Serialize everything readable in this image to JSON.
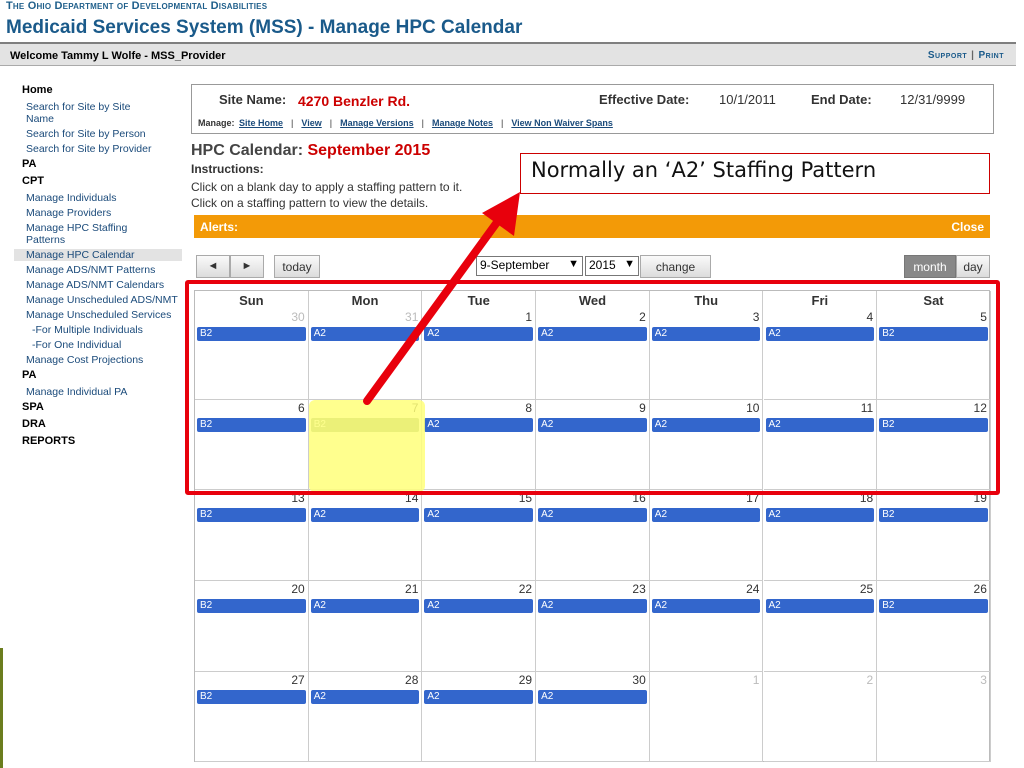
{
  "header": {
    "department": "The Ohio Department of Developmental Disabilities",
    "app_title": "Medicaid Services System (MSS) - Manage HPC Calendar"
  },
  "welcome": {
    "text": "Welcome Tammy L Wolfe - MSS_Provider",
    "support": "Support",
    "separator": "|",
    "print": "Print"
  },
  "sidebar": {
    "items": [
      {
        "label": "Home",
        "type": "header"
      },
      {
        "label": "Search for Site by Site Name",
        "type": "link"
      },
      {
        "label": "Search for Site by Person",
        "type": "link"
      },
      {
        "label": "Search for Site by Provider",
        "type": "link"
      },
      {
        "label": "PA",
        "type": "header"
      },
      {
        "label": "CPT",
        "type": "header"
      },
      {
        "label": "Manage Individuals",
        "type": "link"
      },
      {
        "label": "Manage Providers",
        "type": "link"
      },
      {
        "label": "Manage HPC Staffing Patterns",
        "type": "link"
      },
      {
        "label": "Manage HPC Calendar",
        "type": "active"
      },
      {
        "label": "Manage ADS/NMT Patterns",
        "type": "link"
      },
      {
        "label": "Manage ADS/NMT Calendars",
        "type": "link"
      },
      {
        "label": "Manage Unscheduled ADS/NMT",
        "type": "link"
      },
      {
        "label": "Manage Unscheduled Services",
        "type": "link"
      },
      {
        "label": "-For Multiple Individuals",
        "type": "sub"
      },
      {
        "label": "-For One Individual",
        "type": "sub"
      },
      {
        "label": "Manage Cost Projections",
        "type": "link"
      },
      {
        "label": "PA",
        "type": "header"
      },
      {
        "label": "Manage Individual PA",
        "type": "link"
      },
      {
        "label": "SPA",
        "type": "header"
      },
      {
        "label": "DRA",
        "type": "header"
      },
      {
        "label": "REPORTS",
        "type": "header"
      }
    ]
  },
  "site": {
    "name_label": "Site Name:",
    "name_value": "4270 Benzler Rd.",
    "effective_label": "Effective Date:",
    "effective_value": "10/1/2011",
    "end_label": "End Date:",
    "end_value": "12/31/9999",
    "manage_label": "Manage:",
    "links": [
      "Site Home",
      "View",
      "Manage Versions",
      "Manage Notes",
      "View Non Waiver Spans"
    ]
  },
  "calendar": {
    "heading": "HPC Calendar:",
    "month_title": "September 2015",
    "instructions_label": "Instructions:",
    "instructions": [
      "Click on a blank day to apply a staffing pattern to it.",
      "Click on a staffing pattern to view the details."
    ],
    "alerts_label": "Alerts:",
    "close_label": "Close",
    "prev_icon": "◄",
    "next_icon": "►",
    "today_label": "today",
    "month_select": "9-September",
    "year_select": "2015",
    "change_label": "change",
    "view_month": "month",
    "view_day": "day",
    "day_headers": [
      "Sun",
      "Mon",
      "Tue",
      "Wed",
      "Thu",
      "Fri",
      "Sat"
    ],
    "weeks": [
      [
        {
          "d": "30",
          "o": true,
          "e": "B2"
        },
        {
          "d": "31",
          "o": true,
          "e": "A2"
        },
        {
          "d": "1",
          "e": "A2"
        },
        {
          "d": "2",
          "e": "A2"
        },
        {
          "d": "3",
          "e": "A2"
        },
        {
          "d": "4",
          "e": "A2"
        },
        {
          "d": "5",
          "e": "B2"
        }
      ],
      [
        {
          "d": "6",
          "e": "B2"
        },
        {
          "d": "7",
          "e": "B2",
          "hl": true
        },
        {
          "d": "8",
          "e": "A2"
        },
        {
          "d": "9",
          "e": "A2"
        },
        {
          "d": "10",
          "e": "A2"
        },
        {
          "d": "11",
          "e": "A2"
        },
        {
          "d": "12",
          "e": "B2"
        }
      ],
      [
        {
          "d": "13",
          "e": "B2"
        },
        {
          "d": "14",
          "e": "A2"
        },
        {
          "d": "15",
          "e": "A2"
        },
        {
          "d": "16",
          "e": "A2"
        },
        {
          "d": "17",
          "e": "A2"
        },
        {
          "d": "18",
          "e": "A2"
        },
        {
          "d": "19",
          "e": "B2"
        }
      ],
      [
        {
          "d": "20",
          "e": "B2"
        },
        {
          "d": "21",
          "e": "A2"
        },
        {
          "d": "22",
          "e": "A2"
        },
        {
          "d": "23",
          "e": "A2"
        },
        {
          "d": "24",
          "e": "A2"
        },
        {
          "d": "25",
          "e": "A2"
        },
        {
          "d": "26",
          "e": "B2"
        }
      ],
      [
        {
          "d": "27",
          "e": "B2"
        },
        {
          "d": "28",
          "e": "A2"
        },
        {
          "d": "29",
          "e": "A2"
        },
        {
          "d": "30",
          "e": "A2"
        },
        {
          "d": "1",
          "o": true
        },
        {
          "d": "2",
          "o": true
        },
        {
          "d": "3",
          "o": true
        }
      ]
    ]
  },
  "annotation": {
    "callout_text": "Normally an ‘A2’ Staffing Pattern",
    "arrow_color": "#e8000c",
    "highlight_color": "#ffff7a"
  },
  "colors": {
    "title_blue": "#1a5a8a",
    "alert_orange": "#f39a07",
    "event_blue": "#3366cc",
    "red": "#cc0000"
  }
}
